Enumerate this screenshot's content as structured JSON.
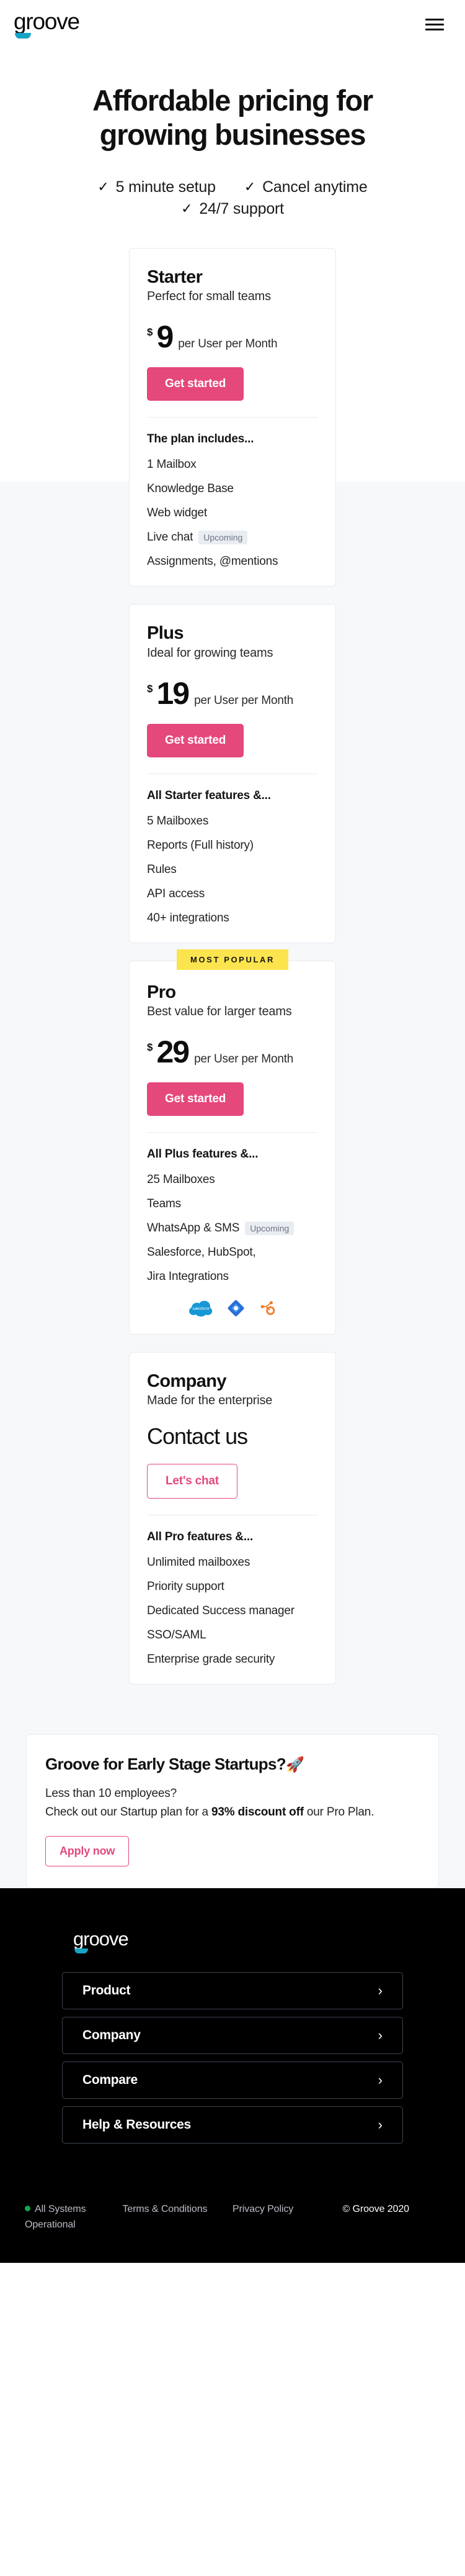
{
  "brand": {
    "name": "groove",
    "accent_blue": "#17a3c6",
    "accent_pink": "#e5487b",
    "badge_yellow": "#fbe44d"
  },
  "nav": {
    "logo": "groove",
    "menu_icon": "hamburger-icon"
  },
  "hero": {
    "title": "Affordable pricing for growing businesses",
    "checks": [
      "5 minute setup",
      "Cancel anytime",
      "24/7 support"
    ],
    "tick": "✓"
  },
  "plans": [
    {
      "name": "Starter",
      "tagline": "Perfect for small teams",
      "currency": "$",
      "amount": "9",
      "period": "per User per Month",
      "cta": "Get started",
      "cta_style": "primary",
      "features_heading": "The plan includes...",
      "features": [
        {
          "label": "1 Mailbox"
        },
        {
          "label": "Knowledge Base"
        },
        {
          "label": "Web widget"
        },
        {
          "label": "Live chat",
          "pill": "Upcoming"
        },
        {
          "label": "Assignments, @mentions"
        }
      ],
      "badge": null,
      "integrations": []
    },
    {
      "name": "Plus",
      "tagline": "Ideal for growing teams",
      "currency": "$",
      "amount": "19",
      "period": "per User per Month",
      "cta": "Get started",
      "cta_style": "primary",
      "features_heading": "All Starter features &...",
      "features": [
        {
          "label": "5 Mailboxes"
        },
        {
          "label": "Reports (Full history)"
        },
        {
          "label": "Rules"
        },
        {
          "label": "API access"
        },
        {
          "label": "40+ integrations"
        }
      ],
      "badge": null,
      "integrations": []
    },
    {
      "name": "Pro",
      "tagline": "Best value for larger teams",
      "currency": "$",
      "amount": "29",
      "period": "per User per Month",
      "cta": "Get started",
      "cta_style": "primary",
      "features_heading": "All Plus features &...",
      "features": [
        {
          "label": "25 Mailboxes"
        },
        {
          "label": "Teams"
        },
        {
          "label": "WhatsApp & SMS",
          "pill": "Upcoming"
        },
        {
          "label": "Salesforce, HubSpot,"
        },
        {
          "label": "Jira Integrations"
        }
      ],
      "badge": "MOST POPULAR",
      "integrations": [
        "salesforce-icon",
        "jira-icon",
        "hubspot-icon"
      ]
    },
    {
      "name": "Company",
      "tagline": "Made for the enterprise",
      "contact_headline": "Contact us",
      "cta": "Let's chat",
      "cta_style": "outline",
      "features_heading": "All Pro features &...",
      "features": [
        {
          "label": "Unlimited mailboxes"
        },
        {
          "label": "Priority support"
        },
        {
          "label": "Dedicated Success manager"
        },
        {
          "label": "SSO/SAML"
        },
        {
          "label": "Enterprise grade security"
        }
      ],
      "badge": null,
      "integrations": []
    }
  ],
  "startup_banner": {
    "title": "Groove for Early Stage Startups?",
    "emoji": "🚀",
    "line1": "Less than 10 employees?",
    "line2_before": "Check out our Startup plan for a ",
    "line2_bold": "93% discount off",
    "line2_after": " our Pro Plan.",
    "cta": "Apply now"
  },
  "footer": {
    "logo": "groove",
    "sections": [
      {
        "label": "Product",
        "chevron": "›"
      },
      {
        "label": "Company",
        "chevron": "›"
      },
      {
        "label": "Compare",
        "chevron": "›"
      },
      {
        "label": "Help & Resources",
        "chevron": "›"
      }
    ],
    "status": "All Systems Operational",
    "status_color": "#12a54a",
    "terms": "Terms & Conditions",
    "privacy": "Privacy Policy",
    "copyright": "© Groove 2020"
  }
}
